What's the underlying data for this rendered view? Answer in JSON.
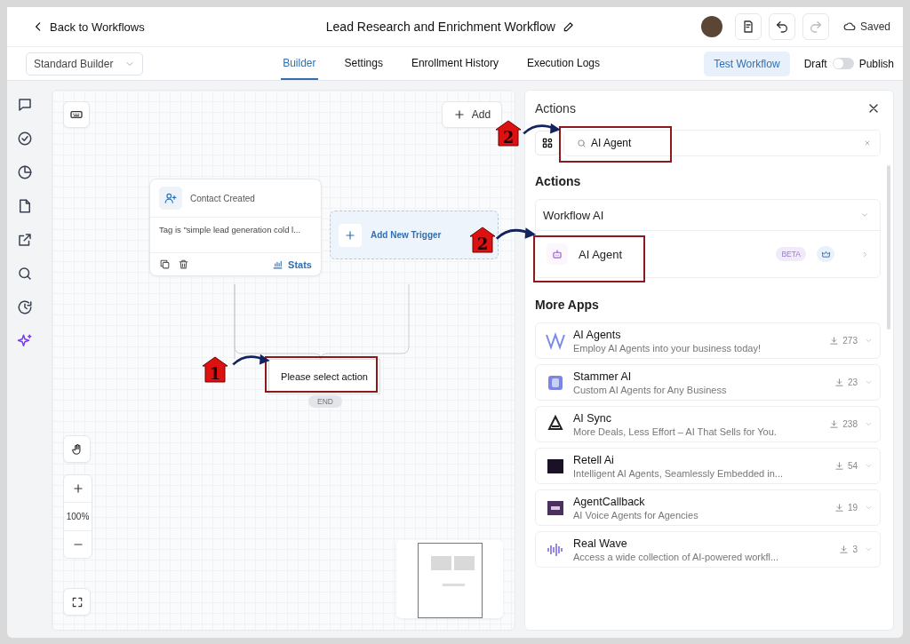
{
  "header": {
    "back_label": "Back to Workflows",
    "title": "Lead Research and Enrichment Workflow",
    "status": "Saved"
  },
  "toolbar": {
    "builder_select": "Standard Builder",
    "tabs": [
      {
        "label": "Builder",
        "selected": true
      },
      {
        "label": "Settings",
        "selected": false
      },
      {
        "label": "Enrollment History",
        "selected": false
      },
      {
        "label": "Execution Logs",
        "selected": false
      }
    ],
    "test_button": "Test Workflow",
    "publish_toggle": {
      "off_label": "Draft",
      "on_label": "Publish",
      "on": false
    }
  },
  "sidebar": {
    "items": [
      {
        "selected": false
      },
      {
        "selected": false
      },
      {
        "selected": false
      },
      {
        "selected": false
      },
      {
        "selected": false
      },
      {
        "selected": false
      },
      {
        "selected": false
      },
      {
        "selected": true
      }
    ]
  },
  "canvas": {
    "add_button": "Add",
    "trigger_node": {
      "title": "Contact Created",
      "condition": "Tag is \"simple lead generation cold l...",
      "stats_label": "Stats"
    },
    "new_trigger": "Add New Trigger",
    "action_node": "Please select action",
    "end_label": "END",
    "zoom": "100%"
  },
  "panel": {
    "title": "Actions",
    "search": {
      "value": "AI Agent"
    },
    "section_title": "Actions",
    "group": {
      "label": "Workflow AI",
      "items": [
        {
          "label": "AI Agent",
          "badge": "BETA"
        }
      ]
    },
    "more_apps_title": "More Apps",
    "apps": [
      {
        "name": "AI Agents",
        "description": "Employ AI Agents into your business today!",
        "installs": "273"
      },
      {
        "name": "Stammer AI",
        "description": "Custom AI Agents for Any Business",
        "installs": "23"
      },
      {
        "name": "AI Sync",
        "description": "More Deals, Less Effort – AI That Sells for You.",
        "installs": "238"
      },
      {
        "name": "Retell Ai",
        "description": "Intelligent AI Agents, Seamlessly Embedded in...",
        "installs": "54"
      },
      {
        "name": "AgentCallback",
        "description": "AI Voice Agents for Agencies",
        "installs": "19"
      },
      {
        "name": "Real Wave",
        "description": "Access a wide collection of AI-powered workfl...",
        "installs": "3"
      }
    ]
  },
  "annotations": [
    {
      "number": "1"
    },
    {
      "number": "2"
    },
    {
      "number": "2"
    }
  ]
}
